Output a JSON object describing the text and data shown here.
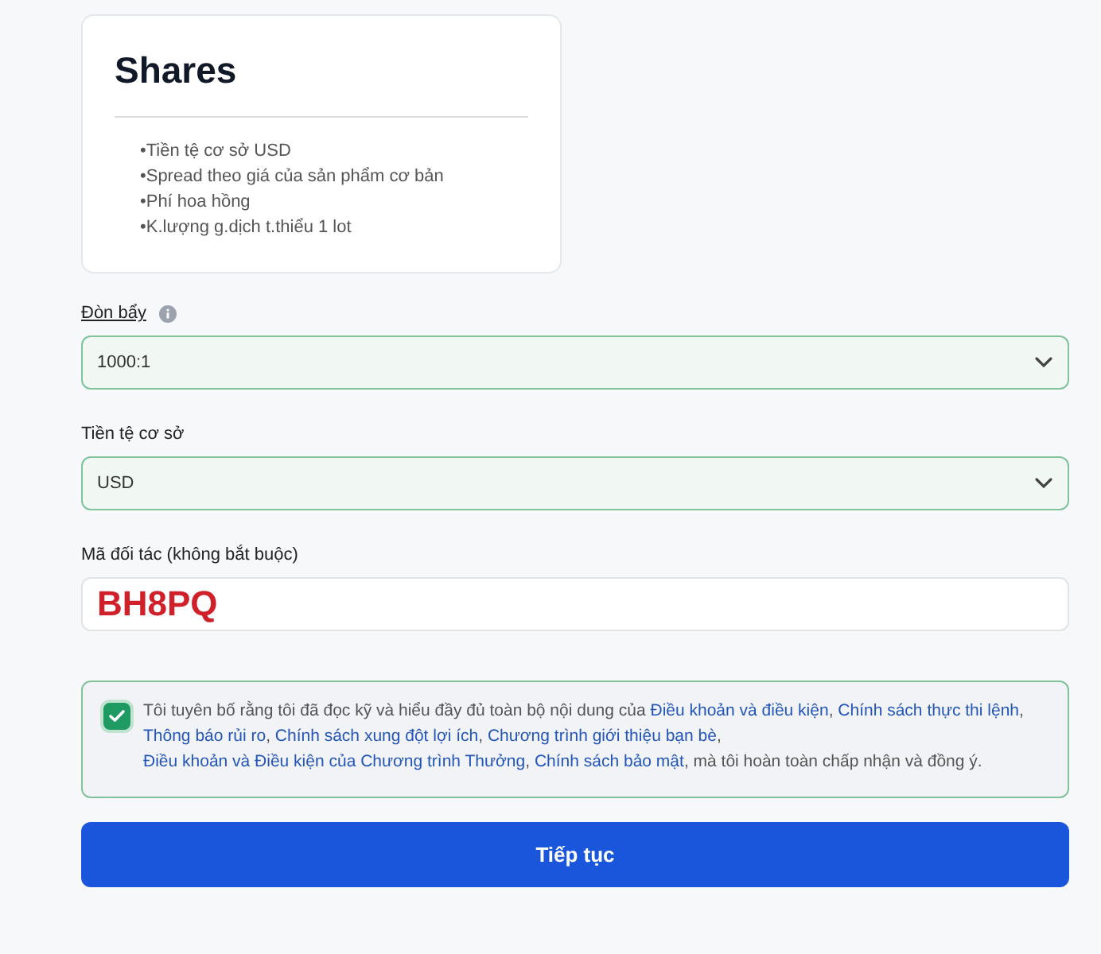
{
  "account_card": {
    "title": "Shares",
    "features": [
      "•Tiền tệ cơ sở USD",
      "•Spread theo giá của sản phẩm cơ bản",
      "•Phí hoa hồng",
      "•K.lượng g.dịch t.thiểu 1 lot"
    ]
  },
  "fields": [
    {
      "kind": "select",
      "label": "Đòn bẩy",
      "info": true,
      "underline": true,
      "value": "1000:1"
    },
    {
      "kind": "select",
      "label": "Tiền tệ cơ sở",
      "info": false,
      "underline": false,
      "value": "USD"
    },
    {
      "kind": "text",
      "label": "Mã đối tác (không bắt buộc)",
      "info": false,
      "underline": false,
      "value": "BH8PQ"
    }
  ],
  "consent": {
    "checked": true,
    "segments": [
      {
        "text": "Tôi tuyên bố rằng tôi đã đọc kỹ và hiểu đầy đủ toàn bộ nội dung của ",
        "link": false
      },
      {
        "text": "Điều khoản và điều kiện",
        "link": true
      },
      {
        "text": ", ",
        "link": false
      },
      {
        "text": "Chính sách thực thi lệnh",
        "link": true
      },
      {
        "text": ", ",
        "link": false
      },
      {
        "text": "Thông báo rủi ro",
        "link": true
      },
      {
        "text": ", ",
        "link": false
      },
      {
        "text": "Chính sách xung đột lợi ích",
        "link": true
      },
      {
        "text": ", ",
        "link": false
      },
      {
        "text": "Chương trình giới thiệu bạn bè",
        "link": true
      },
      {
        "text": ", ",
        "link": false
      },
      {
        "text": "Điều khoản và Điều kiện của Chương trình Thưởng",
        "link": true
      },
      {
        "text": ", ",
        "link": false
      },
      {
        "text": "Chính sách bảo mật",
        "link": true
      },
      {
        "text": ", mà tôi hoàn toàn chấp nhận và đồng ý.",
        "link": false
      }
    ]
  },
  "submit_button": "Tiếp tục"
}
